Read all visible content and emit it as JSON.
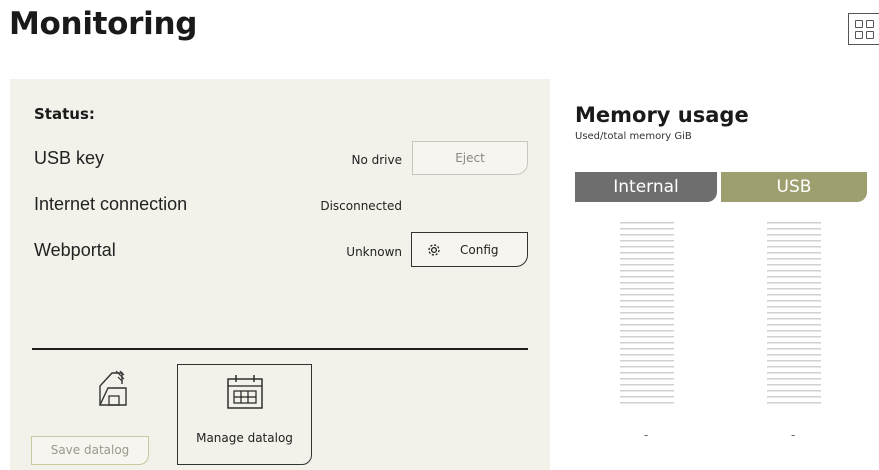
{
  "page": {
    "title": "Monitoring"
  },
  "status": {
    "heading": "Status:",
    "usb": {
      "label": "USB key",
      "value": "No drive",
      "button": "Eject"
    },
    "internet": {
      "label": "Internet connection",
      "value": "Disconnected"
    },
    "webportal": {
      "label": "Webportal",
      "value": "Unknown",
      "button": "Config"
    }
  },
  "datalog": {
    "save_label": "Save datalog",
    "manage_label": "Manage datalog"
  },
  "memory": {
    "title": "Memory usage",
    "subtitle": "Used/total memory GiB",
    "tabs": [
      {
        "label": "Internal",
        "value": "-"
      },
      {
        "label": "USB",
        "value": "-"
      }
    ]
  },
  "colors": {
    "panel_bg": "#f2f1ea",
    "internal_tab": "#6e6e6e",
    "usb_tab": "#9e9f6e"
  },
  "icons": {
    "layout": "grid-view-icon",
    "config": "gear-icon",
    "save": "floppy-save-icon",
    "manage": "calendar-icon"
  }
}
